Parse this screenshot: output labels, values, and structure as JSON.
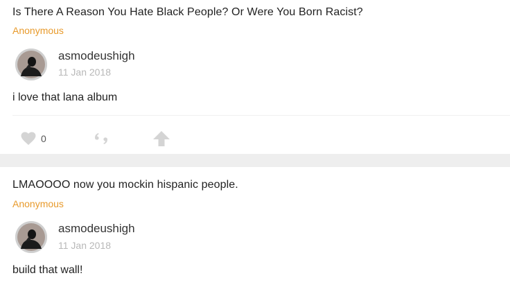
{
  "posts": [
    {
      "question": "Is There A Reason You Hate Black People? Or Were You Born Racist?",
      "asker": "Anonymous",
      "username": "asmodeushigh",
      "date": "11 Jan 2018",
      "answer": "i love that lana album",
      "like_count": "0"
    },
    {
      "question": "LMAOOOO now you mockin hispanic people.",
      "asker": "Anonymous",
      "username": "asmodeushigh",
      "date": "11 Jan 2018",
      "answer": "build that wall!"
    }
  ],
  "icons": {
    "like": "heart-icon",
    "quote": "quote-icon",
    "share": "arrow-up-icon"
  },
  "colors": {
    "asker": "#e89a2b",
    "date": "#b8b8b8",
    "icon": "#d4d4d4",
    "background": "#eeeeee"
  }
}
